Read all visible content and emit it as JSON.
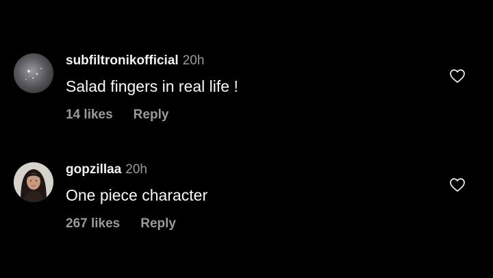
{
  "comments": [
    {
      "username": "subfiltronikofficial",
      "time": "20h",
      "text": "Salad fingers in real life !",
      "likes": "14 likes",
      "reply_label": "Reply"
    },
    {
      "username": "gopzillaa",
      "time": "20h",
      "text": "One piece character",
      "likes": "267 likes",
      "reply_label": "Reply"
    }
  ],
  "icons": {
    "like": "heart-outline-icon"
  },
  "colors": {
    "background": "#000000",
    "primary_text": "#f5f5f5",
    "secondary_text": "#9a9a9a"
  }
}
